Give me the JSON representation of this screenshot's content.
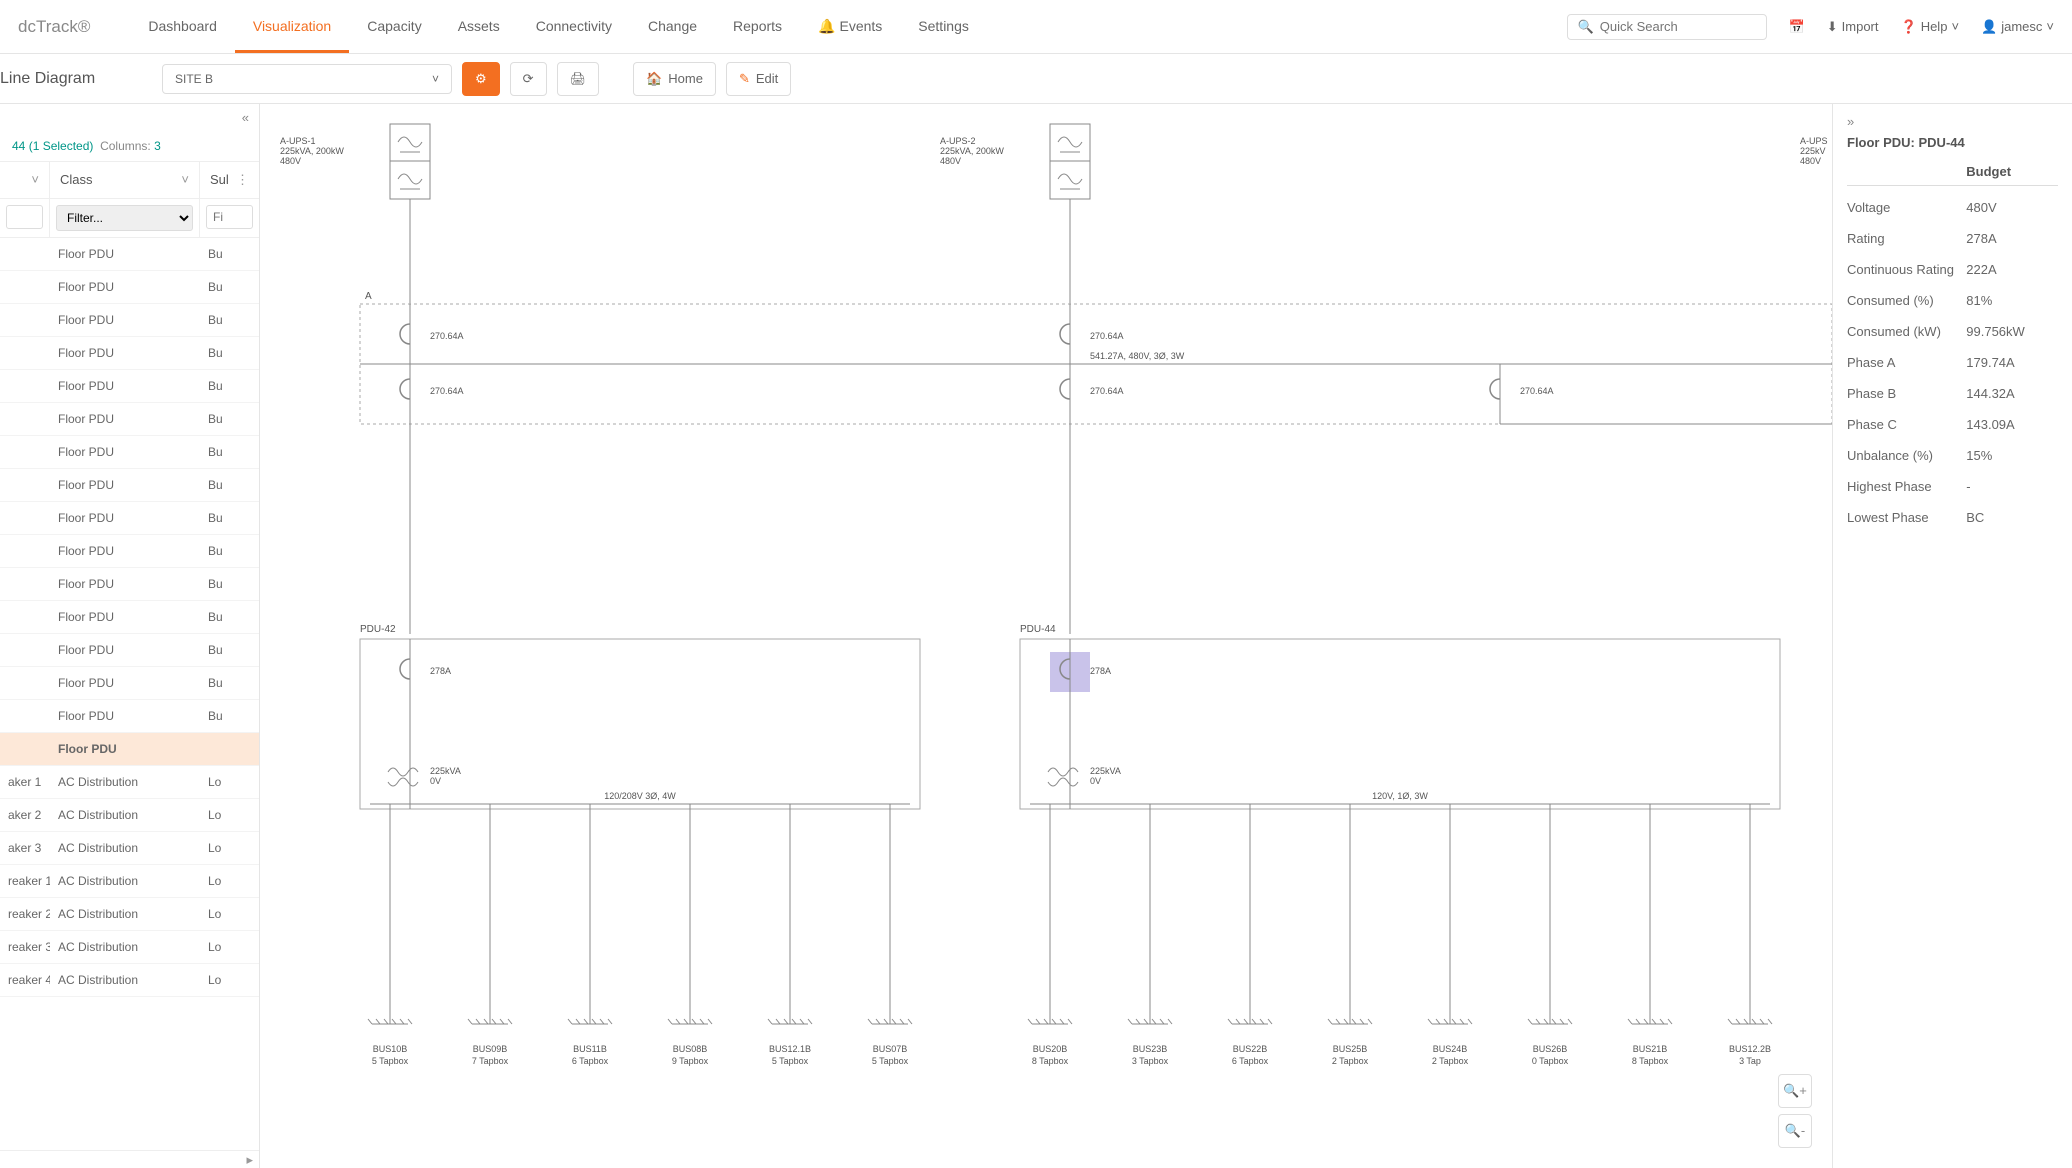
{
  "brand": "dcTrack®",
  "nav": {
    "dashboard": "Dashboard",
    "visualization": "Visualization",
    "capacity": "Capacity",
    "assets": "Assets",
    "connectivity": "Connectivity",
    "change": "Change",
    "reports": "Reports",
    "events": "Events",
    "settings": "Settings"
  },
  "search": {
    "placeholder": "Quick Search"
  },
  "top_right": {
    "import": "Import",
    "help": "Help",
    "user": "jamesc"
  },
  "toolbar": {
    "title": "Line Diagram",
    "site": "SITE B",
    "home": "Home",
    "edit": "Edit"
  },
  "left": {
    "count_prefix": "44",
    "selected": "(1 Selected)",
    "columns_label": "Columns:",
    "columns_count": "3",
    "headers": {
      "c1": "",
      "c2": "Class",
      "c3": "Sul"
    },
    "filter_placeholder": "Filter...",
    "filter3_placeholder": "Fi",
    "rows": [
      {
        "c1": "",
        "c2": "Floor PDU",
        "c3": "Bu",
        "sel": false
      },
      {
        "c1": "",
        "c2": "Floor PDU",
        "c3": "Bu",
        "sel": false
      },
      {
        "c1": "",
        "c2": "Floor PDU",
        "c3": "Bu",
        "sel": false
      },
      {
        "c1": "",
        "c2": "Floor PDU",
        "c3": "Bu",
        "sel": false
      },
      {
        "c1": "",
        "c2": "Floor PDU",
        "c3": "Bu",
        "sel": false
      },
      {
        "c1": "",
        "c2": "Floor PDU",
        "c3": "Bu",
        "sel": false
      },
      {
        "c1": "",
        "c2": "Floor PDU",
        "c3": "Bu",
        "sel": false
      },
      {
        "c1": "",
        "c2": "Floor PDU",
        "c3": "Bu",
        "sel": false
      },
      {
        "c1": "",
        "c2": "Floor PDU",
        "c3": "Bu",
        "sel": false
      },
      {
        "c1": "",
        "c2": "Floor PDU",
        "c3": "Bu",
        "sel": false
      },
      {
        "c1": "",
        "c2": "Floor PDU",
        "c3": "Bu",
        "sel": false
      },
      {
        "c1": "",
        "c2": "Floor PDU",
        "c3": "Bu",
        "sel": false
      },
      {
        "c1": "",
        "c2": "Floor PDU",
        "c3": "Bu",
        "sel": false
      },
      {
        "c1": "",
        "c2": "Floor PDU",
        "c3": "Bu",
        "sel": false
      },
      {
        "c1": "",
        "c2": "Floor PDU",
        "c3": "Bu",
        "sel": false
      },
      {
        "c1": "",
        "c2": "Floor PDU",
        "c3": "",
        "sel": true
      },
      {
        "c1": "aker 1",
        "c2": "AC Distribution",
        "c3": "Lo",
        "sel": false
      },
      {
        "c1": "aker 2",
        "c2": "AC Distribution",
        "c3": "Lo",
        "sel": false
      },
      {
        "c1": "aker 3",
        "c2": "AC Distribution",
        "c3": "Lo",
        "sel": false
      },
      {
        "c1": "reaker 1",
        "c2": "AC Distribution",
        "c3": "Lo",
        "sel": false
      },
      {
        "c1": "reaker 2",
        "c2": "AC Distribution",
        "c3": "Lo",
        "sel": false
      },
      {
        "c1": "reaker 3",
        "c2": "AC Distribution",
        "c3": "Lo",
        "sel": false
      },
      {
        "c1": "reaker 4",
        "c2": "AC Distribution",
        "c3": "Lo",
        "sel": false
      }
    ]
  },
  "diagram": {
    "ups1": {
      "name": "A-UPS-1",
      "spec": "225kVA, 200kW",
      "volt": "480V"
    },
    "ups2": {
      "name": "A-UPS-2",
      "spec": "225kVA, 200kW",
      "volt": "480V"
    },
    "ups3": {
      "name": "A-UPS",
      "spec": "225kV",
      "volt": "480V"
    },
    "bus_label": "A",
    "bus_spec": "541.27A, 480V, 3Ø, 3W",
    "breaker_amps": "270.64A",
    "pdu42": {
      "name": "PDU-42",
      "amps": "278A",
      "xfmr": "225kVA",
      "xfmr_v": "0V",
      "busbar": "120/208V 3Ø, 4W"
    },
    "pdu44": {
      "name": "PDU-44",
      "amps": "278A",
      "xfmr": "225kVA",
      "xfmr_v": "0V",
      "busbar": "120V, 1Ø, 3W"
    },
    "taps42": [
      {
        "name": "BUS10B",
        "sub": "5 Tapbox"
      },
      {
        "name": "BUS09B",
        "sub": "7 Tapbox"
      },
      {
        "name": "BUS11B",
        "sub": "6 Tapbox"
      },
      {
        "name": "BUS08B",
        "sub": "9 Tapbox"
      },
      {
        "name": "BUS12.1B",
        "sub": "5 Tapbox"
      },
      {
        "name": "BUS07B",
        "sub": "5 Tapbox"
      }
    ],
    "taps44": [
      {
        "name": "BUS20B",
        "sub": "8 Tapbox"
      },
      {
        "name": "BUS23B",
        "sub": "3 Tapbox"
      },
      {
        "name": "BUS22B",
        "sub": "6 Tapbox"
      },
      {
        "name": "BUS25B",
        "sub": "2 Tapbox"
      },
      {
        "name": "BUS24B",
        "sub": "2 Tapbox"
      },
      {
        "name": "BUS26B",
        "sub": "0 Tapbox"
      },
      {
        "name": "BUS21B",
        "sub": "8 Tapbox"
      },
      {
        "name": "BUS12.2B",
        "sub": "3 Tap"
      }
    ]
  },
  "details": {
    "title": "Floor PDU: PDU-44",
    "col_budget": "Budget",
    "rows": [
      {
        "l": "Voltage",
        "r": "480V"
      },
      {
        "l": "Rating",
        "r": "278A"
      },
      {
        "l": "Continuous Rating",
        "r": "222A"
      },
      {
        "l": "Consumed (%)",
        "r": "81%"
      },
      {
        "l": "Consumed (kW)",
        "r": "99.756kW"
      },
      {
        "l": "Phase A",
        "r": "179.74A"
      },
      {
        "l": "Phase B",
        "r": "144.32A"
      },
      {
        "l": "Phase C",
        "r": "143.09A"
      },
      {
        "l": "Unbalance (%)",
        "r": "15%"
      },
      {
        "l": "Highest Phase",
        "r": "-"
      },
      {
        "l": "Lowest Phase",
        "r": "BC"
      }
    ]
  }
}
